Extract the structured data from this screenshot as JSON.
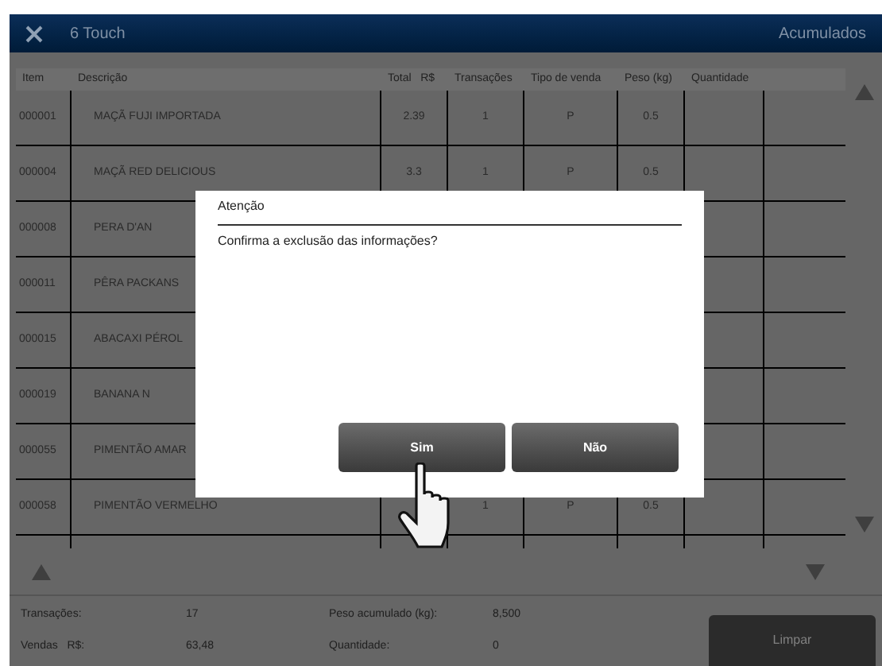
{
  "window": {
    "title": "6 Touch",
    "section": "Acumulados"
  },
  "table": {
    "columns": [
      "Item",
      "Descrição",
      "Total   R$",
      "Transações",
      "Tipo de venda",
      "Peso (kg)",
      "Quantidade"
    ],
    "rows": [
      {
        "item": "000001",
        "description": "MAÇÃ FUJI IMPORTADA",
        "total": "2.39",
        "transactions": "1",
        "sale_type": "P",
        "weight": "0.5"
      },
      {
        "item": "000004",
        "description": "MAÇÃ RED DELICIOUS",
        "total": "3.3",
        "transactions": "1",
        "sale_type": "P",
        "weight": "0.5"
      },
      {
        "item": "000008",
        "description": "PERA D'AN"
      },
      {
        "item": "000011",
        "description": "PÊRA PACKANS"
      },
      {
        "item": "000015",
        "description": "ABACAXI PÉROL"
      },
      {
        "item": "000019",
        "description": "BANANA N"
      },
      {
        "item": "000055",
        "description": "PIMENTÃO AMAR"
      },
      {
        "item": "000058",
        "description": "PIMENTÃO VERMELHO",
        "transactions": "1",
        "sale_type": "P",
        "weight": "0.5"
      }
    ]
  },
  "summary": [
    {
      "label": "Transações:",
      "value": "17"
    },
    {
      "label": "Peso acumulado (kg):",
      "value": "8,500"
    },
    {
      "label": "Vendas   R$:",
      "value": "63,48"
    },
    {
      "label": "Quantidade:",
      "value": "0"
    }
  ],
  "clear_button": "Limpar",
  "dialog": {
    "title": "Atenção",
    "message": "Confirma a exclusão das informações?",
    "buttons": [
      "Sim",
      "Não"
    ]
  }
}
